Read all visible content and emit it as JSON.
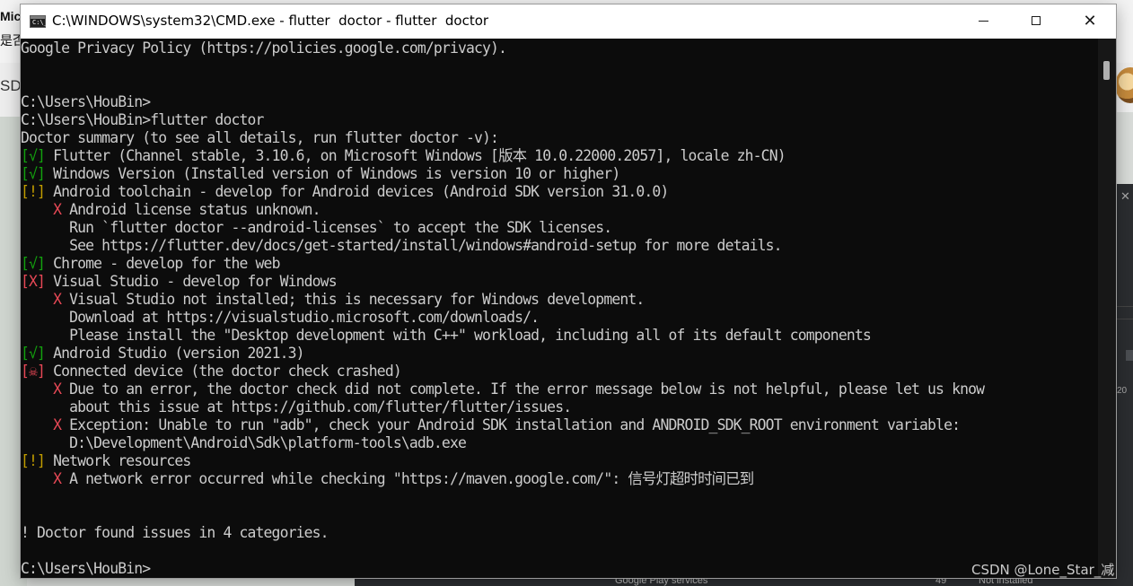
{
  "background": {
    "fragment_mid": "Mic",
    "fragment_shi": "是否",
    "fragment_sd": "SD",
    "ide_close": "✕",
    "ide_number": "20",
    "bottom_google": "Google Play services",
    "bottom_count": "49",
    "bottom_status": "Not installed"
  },
  "window": {
    "icon_label": "C:\\_",
    "title": "C:\\WINDOWS\\system32\\CMD.exe - flutter  doctor - flutter  doctor",
    "minimize_glyph": "—",
    "maximize_glyph": "☐",
    "close_glyph": "✕"
  },
  "console": {
    "lines": [
      {
        "segments": [
          {
            "text": "Google Privacy Policy (https://policies.google.com/privacy).",
            "color": "white"
          }
        ]
      },
      {
        "segments": [
          {
            "text": "",
            "color": "white"
          }
        ]
      },
      {
        "segments": [
          {
            "text": "",
            "color": "white"
          }
        ]
      },
      {
        "segments": [
          {
            "text": "C:\\Users\\HouBin>",
            "color": "white"
          }
        ]
      },
      {
        "segments": [
          {
            "text": "C:\\Users\\HouBin>flutter doctor",
            "color": "white"
          }
        ]
      },
      {
        "segments": [
          {
            "text": "Doctor summary (to see all details, run flutter doctor -v):",
            "color": "white"
          }
        ]
      },
      {
        "segments": [
          {
            "text": "[√]",
            "color": "green"
          },
          {
            "text": " Flutter (Channel stable, 3.10.6, on Microsoft Windows [版本 10.0.22000.2057], locale zh-CN)",
            "color": "white"
          }
        ]
      },
      {
        "segments": [
          {
            "text": "[√]",
            "color": "green"
          },
          {
            "text": " Windows Version (Installed version of Windows is version 10 or higher)",
            "color": "white"
          }
        ]
      },
      {
        "segments": [
          {
            "text": "[!]",
            "color": "yellow"
          },
          {
            "text": " Android toolchain - develop for Android devices (Android SDK version 31.0.0)",
            "color": "white"
          }
        ]
      },
      {
        "segments": [
          {
            "text": "    ",
            "color": "white"
          },
          {
            "text": "X",
            "color": "red"
          },
          {
            "text": " Android license status unknown.",
            "color": "white"
          }
        ]
      },
      {
        "segments": [
          {
            "text": "      Run `flutter doctor --android-licenses` to accept the SDK licenses.",
            "color": "white"
          }
        ]
      },
      {
        "segments": [
          {
            "text": "      See https://flutter.dev/docs/get-started/install/windows#android-setup for more details.",
            "color": "white"
          }
        ]
      },
      {
        "segments": [
          {
            "text": "[√]",
            "color": "green"
          },
          {
            "text": " Chrome - develop for the web",
            "color": "white"
          }
        ]
      },
      {
        "segments": [
          {
            "text": "[X]",
            "color": "red"
          },
          {
            "text": " Visual Studio - develop for Windows",
            "color": "white"
          }
        ]
      },
      {
        "segments": [
          {
            "text": "    ",
            "color": "white"
          },
          {
            "text": "X",
            "color": "red"
          },
          {
            "text": " Visual Studio not installed; this is necessary for Windows development.",
            "color": "white"
          }
        ]
      },
      {
        "segments": [
          {
            "text": "      Download at https://visualstudio.microsoft.com/downloads/.",
            "color": "white"
          }
        ]
      },
      {
        "segments": [
          {
            "text": "      Please install the \"Desktop development with C++\" workload, including all of its default components",
            "color": "white"
          }
        ]
      },
      {
        "segments": [
          {
            "text": "[√]",
            "color": "green"
          },
          {
            "text": " Android Studio (version 2021.3)",
            "color": "white"
          }
        ]
      },
      {
        "segments": [
          {
            "text": "[☠]",
            "color": "red"
          },
          {
            "text": " Connected device (the doctor check crashed)",
            "color": "white"
          }
        ]
      },
      {
        "segments": [
          {
            "text": "    ",
            "color": "white"
          },
          {
            "text": "X",
            "color": "red"
          },
          {
            "text": " Due to an error, the doctor check did not complete. If the error message below is not helpful, please let us know",
            "color": "white"
          }
        ]
      },
      {
        "segments": [
          {
            "text": "      about this issue at https://github.com/flutter/flutter/issues.",
            "color": "white"
          }
        ]
      },
      {
        "segments": [
          {
            "text": "    ",
            "color": "white"
          },
          {
            "text": "X",
            "color": "red"
          },
          {
            "text": " Exception: Unable to run \"adb\", check your Android SDK installation and ANDROID_SDK_ROOT environment variable:",
            "color": "white"
          }
        ]
      },
      {
        "segments": [
          {
            "text": "      D:\\Development\\Android\\Sdk\\platform-tools\\adb.exe",
            "color": "white"
          }
        ]
      },
      {
        "segments": [
          {
            "text": "[!]",
            "color": "yellow"
          },
          {
            "text": " Network resources",
            "color": "white"
          }
        ]
      },
      {
        "segments": [
          {
            "text": "    ",
            "color": "white"
          },
          {
            "text": "X",
            "color": "red"
          },
          {
            "text": " A network error occurred while checking \"https://maven.google.com/\": 信号灯超时时间已到",
            "color": "white"
          }
        ]
      },
      {
        "segments": [
          {
            "text": "",
            "color": "white"
          }
        ]
      },
      {
        "segments": [
          {
            "text": "",
            "color": "white"
          }
        ]
      },
      {
        "segments": [
          {
            "text": "! Doctor found issues in 4 categories.",
            "color": "white"
          }
        ]
      },
      {
        "segments": [
          {
            "text": "",
            "color": "white"
          }
        ]
      },
      {
        "segments": [
          {
            "text": "C:\\Users\\HouBin>",
            "color": "white"
          }
        ]
      }
    ]
  },
  "watermark": "CSDN @Lone_Star_减"
}
